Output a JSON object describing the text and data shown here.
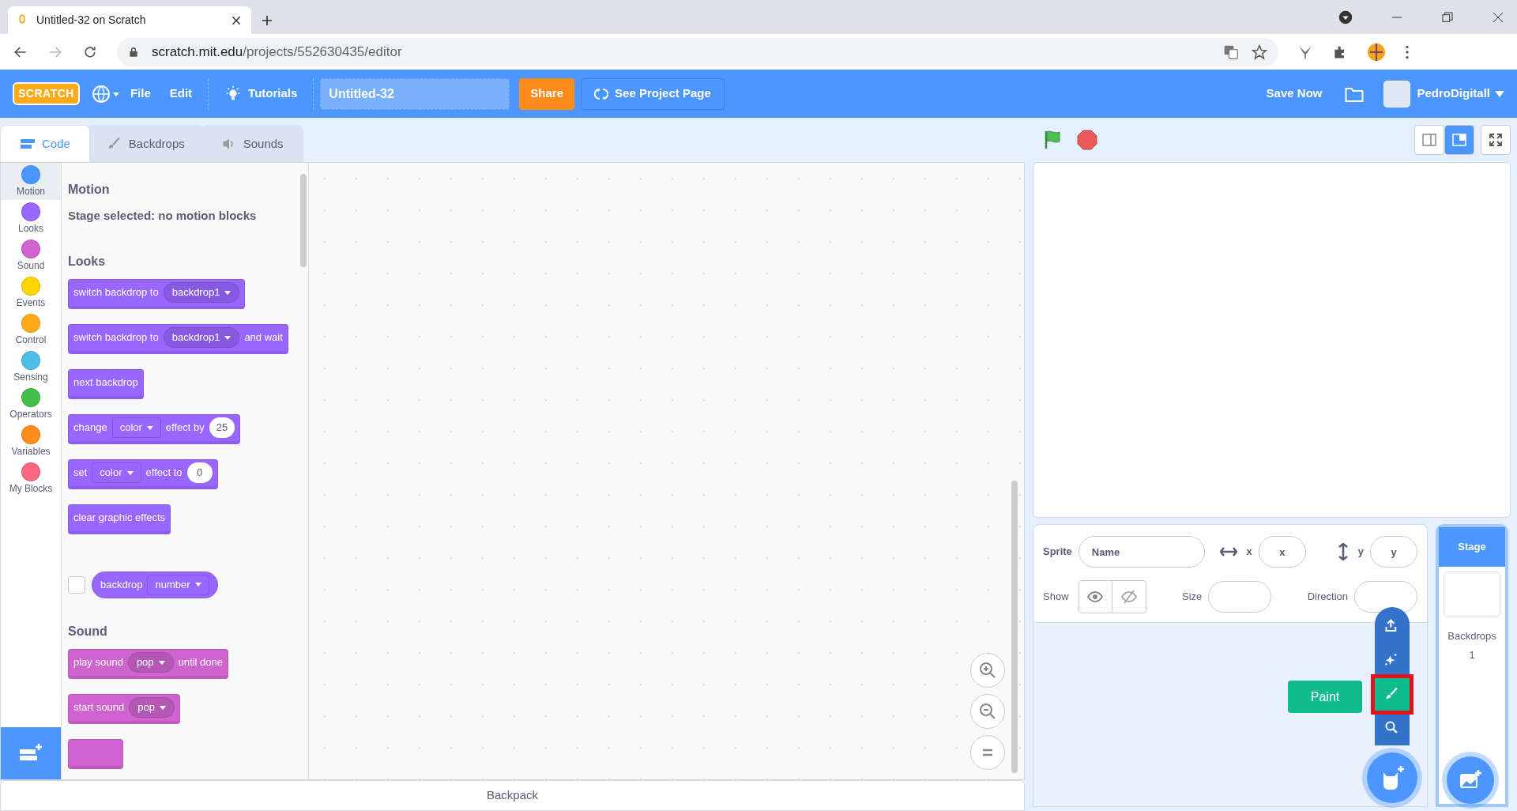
{
  "browser": {
    "tab_title": "Untitled-32 on Scratch",
    "url_host": "scratch.mit.edu",
    "url_path": "/projects/552630435/editor"
  },
  "menu_bar": {
    "logo_text": "SCRATCH",
    "items": [
      {
        "label": "File"
      },
      {
        "label": "Edit"
      }
    ],
    "tutorials": "Tutorials",
    "project_title": "Untitled-32",
    "share": "Share",
    "see_project_page": "See Project Page",
    "save_now": "Save Now",
    "username": "PedroDigitall"
  },
  "editor_tabs": [
    {
      "label": "Code",
      "selected": true
    },
    {
      "label": "Backdrops",
      "selected": false
    },
    {
      "label": "Sounds",
      "selected": false
    }
  ],
  "categories": [
    {
      "label": "Motion",
      "color": "#4c97ff",
      "selected": true
    },
    {
      "label": "Looks",
      "color": "#9966ff",
      "selected": false
    },
    {
      "label": "Sound",
      "color": "#cf63cf",
      "selected": false
    },
    {
      "label": "Events",
      "color": "#ffd500",
      "selected": false
    },
    {
      "label": "Control",
      "color": "#ffab19",
      "selected": false
    },
    {
      "label": "Sensing",
      "color": "#4cbfe6",
      "selected": false
    },
    {
      "label": "Operators",
      "color": "#40bf4a",
      "selected": false
    },
    {
      "label": "Variables",
      "color": "#ff8c1a",
      "selected": false
    },
    {
      "label": "My Blocks",
      "color": "#ff6680",
      "selected": false
    }
  ],
  "palette": [
    {
      "title": "Motion",
      "items": [
        {
          "kind": "note",
          "text": "Stage selected: no motion blocks"
        }
      ]
    },
    {
      "title": "Looks",
      "items": [
        {
          "kind": "stack",
          "color": "#9966ff",
          "parts": [
            {
              "kind": "text",
              "text": "switch backdrop to"
            },
            {
              "kind": "menu",
              "text": "backdrop1"
            }
          ]
        },
        {
          "kind": "stack",
          "color": "#9966ff",
          "parts": [
            {
              "kind": "text",
              "text": "switch backdrop to"
            },
            {
              "kind": "menu",
              "text": "backdrop1"
            },
            {
              "kind": "text",
              "text": "and wait"
            }
          ]
        },
        {
          "kind": "stack",
          "color": "#9966ff",
          "parts": [
            {
              "kind": "text",
              "text": "next backdrop"
            }
          ]
        },
        {
          "kind": "stack",
          "color": "#9966ff",
          "parts": [
            {
              "kind": "text",
              "text": "change"
            },
            {
              "kind": "field",
              "text": "color"
            },
            {
              "kind": "text",
              "text": "effect by"
            },
            {
              "kind": "number",
              "text": "25"
            }
          ]
        },
        {
          "kind": "stack",
          "color": "#9966ff",
          "parts": [
            {
              "kind": "text",
              "text": "set"
            },
            {
              "kind": "field",
              "text": "color"
            },
            {
              "kind": "text",
              "text": "effect to"
            },
            {
              "kind": "number",
              "text": "0"
            }
          ]
        },
        {
          "kind": "stack",
          "color": "#9966ff",
          "parts": [
            {
              "kind": "text",
              "text": "clear graphic effects"
            }
          ]
        },
        {
          "kind": "reporter",
          "color": "#9966ff",
          "checked": false,
          "parts": [
            {
              "kind": "text",
              "text": "backdrop"
            },
            {
              "kind": "field",
              "text": "number"
            }
          ]
        }
      ]
    },
    {
      "title": "Sound",
      "items": [
        {
          "kind": "stack",
          "color": "#cf63cf",
          "parts": [
            {
              "kind": "text",
              "text": "play sound"
            },
            {
              "kind": "menu",
              "text": "pop"
            },
            {
              "kind": "text",
              "text": "until done"
            }
          ]
        },
        {
          "kind": "stack",
          "color": "#cf63cf",
          "parts": [
            {
              "kind": "text",
              "text": "start sound"
            },
            {
              "kind": "menu",
              "text": "pop"
            }
          ]
        },
        {
          "kind": "stub",
          "color": "#cf63cf"
        }
      ]
    }
  ],
  "backpack": "Backpack",
  "sprite_info": {
    "sprite_label": "Sprite",
    "name_placeholder": "Name",
    "x_label": "x",
    "x_placeholder": "x",
    "y_label": "y",
    "y_placeholder": "y",
    "show_label": "Show",
    "size_label": "Size",
    "direction_label": "Direction"
  },
  "sprite_menu": {
    "tooltip": "Paint"
  },
  "stage_panel": {
    "title": "Stage",
    "backdrops_label": "Backdrops",
    "backdrops_count": "1"
  }
}
